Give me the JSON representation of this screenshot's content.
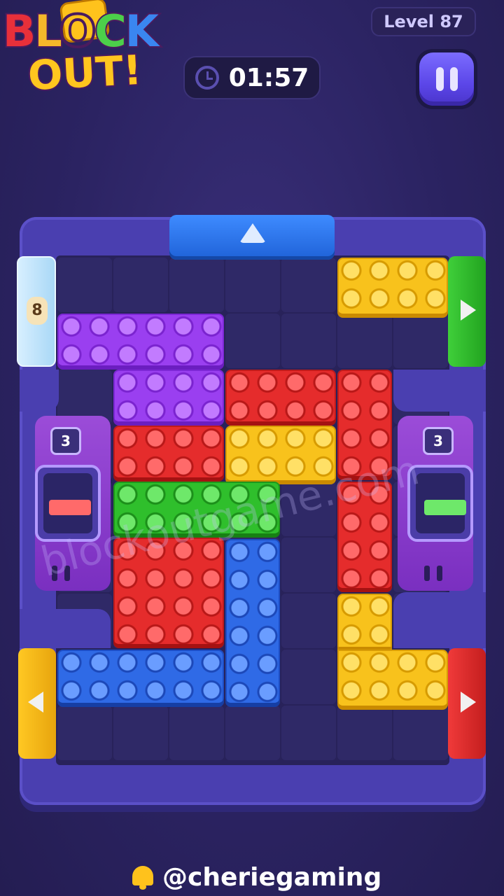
{
  "header": {
    "logo_line1_letters": [
      "B",
      "L",
      "O",
      "C",
      "K"
    ],
    "logo_line2": "OUT!",
    "timer": "01:57",
    "level": "Level 87"
  },
  "board": {
    "ice_gate_count": "8",
    "left_machine": {
      "count": "3",
      "brick_color": "red"
    },
    "right_machine": {
      "count": "3",
      "brick_color": "green"
    },
    "gates": [
      {
        "name": "top",
        "color": "blue",
        "arrow": "up"
      },
      {
        "name": "right-upper",
        "color": "green",
        "arrow": "right"
      },
      {
        "name": "right-lower",
        "color": "red",
        "arrow": "right"
      },
      {
        "name": "left-lower",
        "color": "yellow",
        "arrow": "left"
      },
      {
        "name": "left-upper",
        "color": "ice",
        "arrow": "none"
      }
    ],
    "blocks": [
      {
        "color": "yellow",
        "shape": "2x4"
      },
      {
        "color": "purple",
        "shape": "2x6"
      },
      {
        "color": "purple",
        "shape": "2x4"
      },
      {
        "color": "red",
        "shape": "2x4"
      },
      {
        "color": "red",
        "shape": "4x2"
      },
      {
        "color": "red",
        "shape": "2x4"
      },
      {
        "color": "yellow",
        "shape": "2x4"
      },
      {
        "color": "green",
        "shape": "2x6"
      },
      {
        "color": "red",
        "shape": "4x2"
      },
      {
        "color": "red",
        "shape": "4x4"
      },
      {
        "color": "blue",
        "shape": "6x2"
      },
      {
        "color": "blue",
        "shape": "2x6"
      },
      {
        "color": "yellow",
        "shape": "L"
      }
    ]
  },
  "watermark": "blockoutgame.com",
  "footer": {
    "handle": "@cheriegaming"
  }
}
